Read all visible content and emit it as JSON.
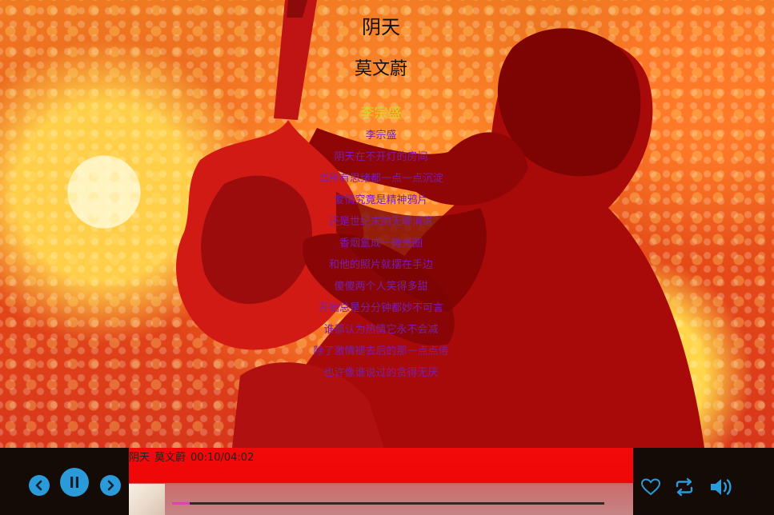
{
  "song": {
    "title": "阴天",
    "artist": "莫文蔚"
  },
  "lyrics": {
    "current": "李宗盛",
    "lines": [
      "李宗盛",
      "阴天在不开灯的房间",
      "当所有思绪都一点一点沉淀",
      "爱情究竟是精神鸦片",
      "还是世纪末的无聊消遣",
      "香烟氲成一摊光圈",
      "和他的照片就摆在手边",
      "傻傻两个人笑得多甜",
      "开始总是分分钟都妙不可言",
      "谁都认为热情它永不会减",
      "除了激情褪去后的那一点点倦",
      "也许像谁说过的贪得无厌"
    ]
  },
  "player": {
    "now_playing": {
      "title": "阴天",
      "artist": "莫文蔚",
      "time": "00:10/04:02"
    },
    "progress": 0.04,
    "controls": {
      "prev_icon": "chevron-left-icon",
      "play_pause_icon": "pause-icon",
      "next_icon": "chevron-right-icon",
      "like_icon": "heart-icon",
      "repeat_icon": "repeat-icon",
      "volume_icon": "volume-icon"
    }
  },
  "colors": {
    "accent": "#2a9bd8",
    "lyric_current": "#c8e020",
    "lyric_normal": "#7a1fa8",
    "info_bar": "#f20a0a",
    "progress_fill": "#e040b0"
  }
}
